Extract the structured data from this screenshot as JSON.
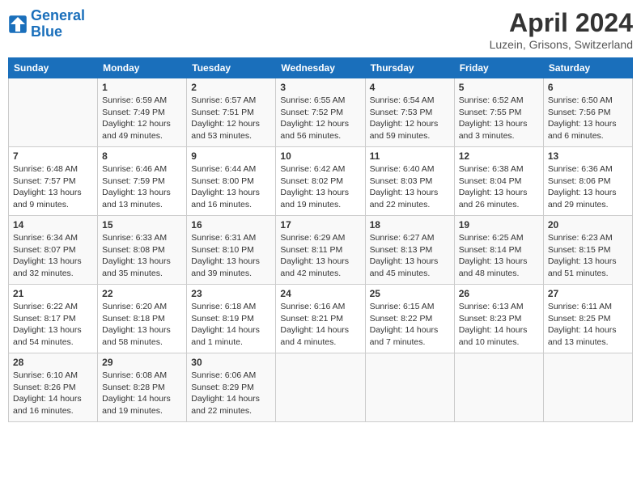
{
  "header": {
    "logo_line1": "General",
    "logo_line2": "Blue",
    "title": "April 2024",
    "location": "Luzein, Grisons, Switzerland"
  },
  "columns": [
    "Sunday",
    "Monday",
    "Tuesday",
    "Wednesday",
    "Thursday",
    "Friday",
    "Saturday"
  ],
  "weeks": [
    [
      {
        "day": "",
        "sunrise": "",
        "sunset": "",
        "daylight": ""
      },
      {
        "day": "1",
        "sunrise": "Sunrise: 6:59 AM",
        "sunset": "Sunset: 7:49 PM",
        "daylight": "Daylight: 12 hours and 49 minutes."
      },
      {
        "day": "2",
        "sunrise": "Sunrise: 6:57 AM",
        "sunset": "Sunset: 7:51 PM",
        "daylight": "Daylight: 12 hours and 53 minutes."
      },
      {
        "day": "3",
        "sunrise": "Sunrise: 6:55 AM",
        "sunset": "Sunset: 7:52 PM",
        "daylight": "Daylight: 12 hours and 56 minutes."
      },
      {
        "day": "4",
        "sunrise": "Sunrise: 6:54 AM",
        "sunset": "Sunset: 7:53 PM",
        "daylight": "Daylight: 12 hours and 59 minutes."
      },
      {
        "day": "5",
        "sunrise": "Sunrise: 6:52 AM",
        "sunset": "Sunset: 7:55 PM",
        "daylight": "Daylight: 13 hours and 3 minutes."
      },
      {
        "day": "6",
        "sunrise": "Sunrise: 6:50 AM",
        "sunset": "Sunset: 7:56 PM",
        "daylight": "Daylight: 13 hours and 6 minutes."
      }
    ],
    [
      {
        "day": "7",
        "sunrise": "Sunrise: 6:48 AM",
        "sunset": "Sunset: 7:57 PM",
        "daylight": "Daylight: 13 hours and 9 minutes."
      },
      {
        "day": "8",
        "sunrise": "Sunrise: 6:46 AM",
        "sunset": "Sunset: 7:59 PM",
        "daylight": "Daylight: 13 hours and 13 minutes."
      },
      {
        "day": "9",
        "sunrise": "Sunrise: 6:44 AM",
        "sunset": "Sunset: 8:00 PM",
        "daylight": "Daylight: 13 hours and 16 minutes."
      },
      {
        "day": "10",
        "sunrise": "Sunrise: 6:42 AM",
        "sunset": "Sunset: 8:02 PM",
        "daylight": "Daylight: 13 hours and 19 minutes."
      },
      {
        "day": "11",
        "sunrise": "Sunrise: 6:40 AM",
        "sunset": "Sunset: 8:03 PM",
        "daylight": "Daylight: 13 hours and 22 minutes."
      },
      {
        "day": "12",
        "sunrise": "Sunrise: 6:38 AM",
        "sunset": "Sunset: 8:04 PM",
        "daylight": "Daylight: 13 hours and 26 minutes."
      },
      {
        "day": "13",
        "sunrise": "Sunrise: 6:36 AM",
        "sunset": "Sunset: 8:06 PM",
        "daylight": "Daylight: 13 hours and 29 minutes."
      }
    ],
    [
      {
        "day": "14",
        "sunrise": "Sunrise: 6:34 AM",
        "sunset": "Sunset: 8:07 PM",
        "daylight": "Daylight: 13 hours and 32 minutes."
      },
      {
        "day": "15",
        "sunrise": "Sunrise: 6:33 AM",
        "sunset": "Sunset: 8:08 PM",
        "daylight": "Daylight: 13 hours and 35 minutes."
      },
      {
        "day": "16",
        "sunrise": "Sunrise: 6:31 AM",
        "sunset": "Sunset: 8:10 PM",
        "daylight": "Daylight: 13 hours and 39 minutes."
      },
      {
        "day": "17",
        "sunrise": "Sunrise: 6:29 AM",
        "sunset": "Sunset: 8:11 PM",
        "daylight": "Daylight: 13 hours and 42 minutes."
      },
      {
        "day": "18",
        "sunrise": "Sunrise: 6:27 AM",
        "sunset": "Sunset: 8:13 PM",
        "daylight": "Daylight: 13 hours and 45 minutes."
      },
      {
        "day": "19",
        "sunrise": "Sunrise: 6:25 AM",
        "sunset": "Sunset: 8:14 PM",
        "daylight": "Daylight: 13 hours and 48 minutes."
      },
      {
        "day": "20",
        "sunrise": "Sunrise: 6:23 AM",
        "sunset": "Sunset: 8:15 PM",
        "daylight": "Daylight: 13 hours and 51 minutes."
      }
    ],
    [
      {
        "day": "21",
        "sunrise": "Sunrise: 6:22 AM",
        "sunset": "Sunset: 8:17 PM",
        "daylight": "Daylight: 13 hours and 54 minutes."
      },
      {
        "day": "22",
        "sunrise": "Sunrise: 6:20 AM",
        "sunset": "Sunset: 8:18 PM",
        "daylight": "Daylight: 13 hours and 58 minutes."
      },
      {
        "day": "23",
        "sunrise": "Sunrise: 6:18 AM",
        "sunset": "Sunset: 8:19 PM",
        "daylight": "Daylight: 14 hours and 1 minute."
      },
      {
        "day": "24",
        "sunrise": "Sunrise: 6:16 AM",
        "sunset": "Sunset: 8:21 PM",
        "daylight": "Daylight: 14 hours and 4 minutes."
      },
      {
        "day": "25",
        "sunrise": "Sunrise: 6:15 AM",
        "sunset": "Sunset: 8:22 PM",
        "daylight": "Daylight: 14 hours and 7 minutes."
      },
      {
        "day": "26",
        "sunrise": "Sunrise: 6:13 AM",
        "sunset": "Sunset: 8:23 PM",
        "daylight": "Daylight: 14 hours and 10 minutes."
      },
      {
        "day": "27",
        "sunrise": "Sunrise: 6:11 AM",
        "sunset": "Sunset: 8:25 PM",
        "daylight": "Daylight: 14 hours and 13 minutes."
      }
    ],
    [
      {
        "day": "28",
        "sunrise": "Sunrise: 6:10 AM",
        "sunset": "Sunset: 8:26 PM",
        "daylight": "Daylight: 14 hours and 16 minutes."
      },
      {
        "day": "29",
        "sunrise": "Sunrise: 6:08 AM",
        "sunset": "Sunset: 8:28 PM",
        "daylight": "Daylight: 14 hours and 19 minutes."
      },
      {
        "day": "30",
        "sunrise": "Sunrise: 6:06 AM",
        "sunset": "Sunset: 8:29 PM",
        "daylight": "Daylight: 14 hours and 22 minutes."
      },
      {
        "day": "",
        "sunrise": "",
        "sunset": "",
        "daylight": ""
      },
      {
        "day": "",
        "sunrise": "",
        "sunset": "",
        "daylight": ""
      },
      {
        "day": "",
        "sunrise": "",
        "sunset": "",
        "daylight": ""
      },
      {
        "day": "",
        "sunrise": "",
        "sunset": "",
        "daylight": ""
      }
    ]
  ]
}
